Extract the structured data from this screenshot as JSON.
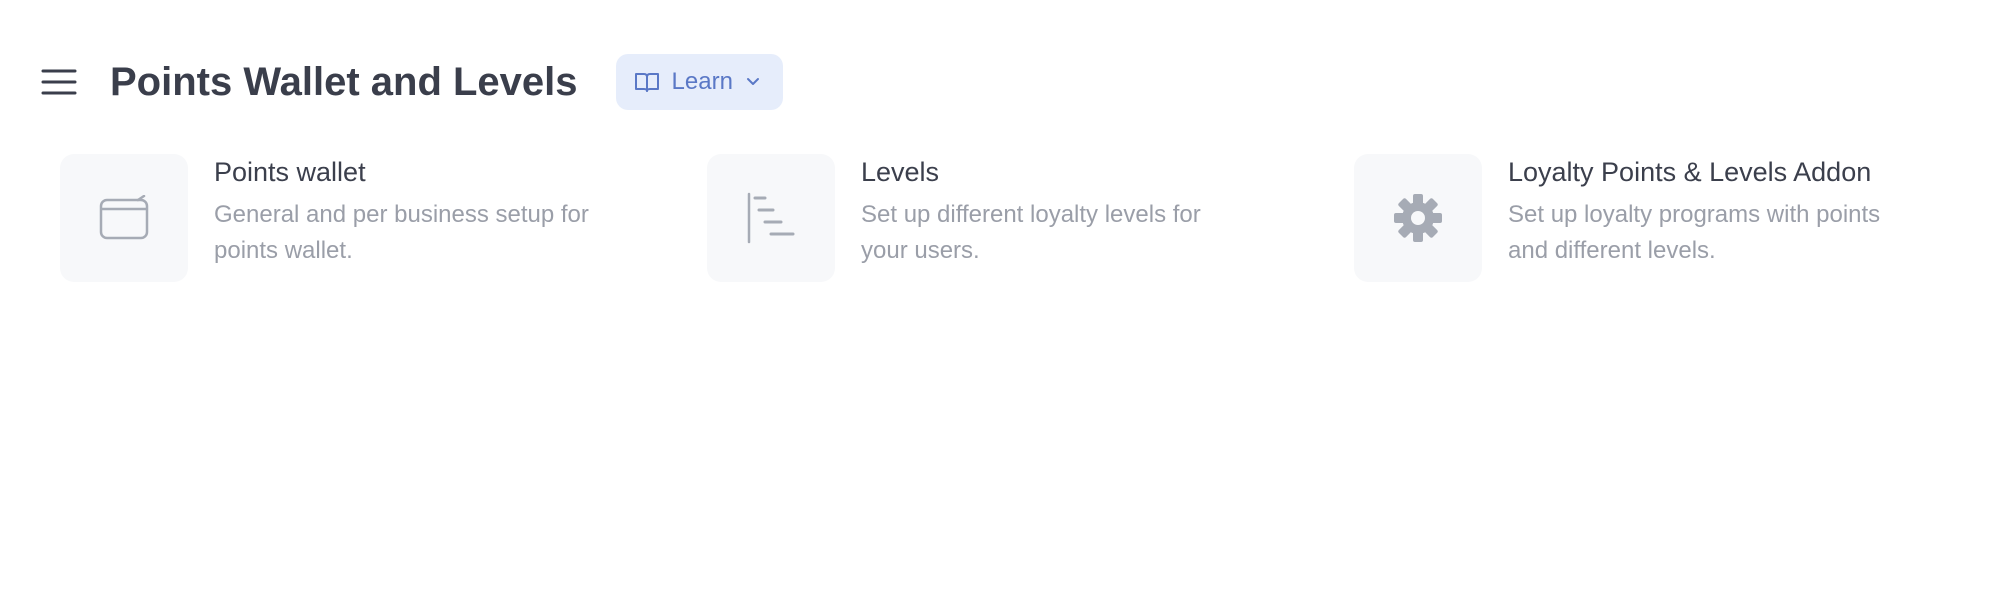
{
  "header": {
    "title": "Points Wallet and Levels",
    "menu_icon": "hamburger-menu-icon",
    "learn": {
      "label": "Learn",
      "icon": "book-open-icon",
      "chevron_icon": "chevron-down-icon"
    }
  },
  "cards": [
    {
      "title": "Points wallet",
      "description": "General and per business setup for points wallet.",
      "icon": "wallet-icon"
    },
    {
      "title": "Levels",
      "description": "Set up different loyalty levels for your users.",
      "icon": "levels-icon"
    },
    {
      "title": "Loyalty Points & Levels Addon",
      "description": "Set up loyalty programs with points and different levels.",
      "icon": "gear-icon"
    }
  ],
  "colors": {
    "title_text": "#3a3e4b",
    "muted_text": "#9a9ea8",
    "learn_bg": "#e6edfb",
    "learn_text": "#5a78c6",
    "icon_tile_bg": "#f7f8fa",
    "icon_stroke": "#a6abb5"
  }
}
